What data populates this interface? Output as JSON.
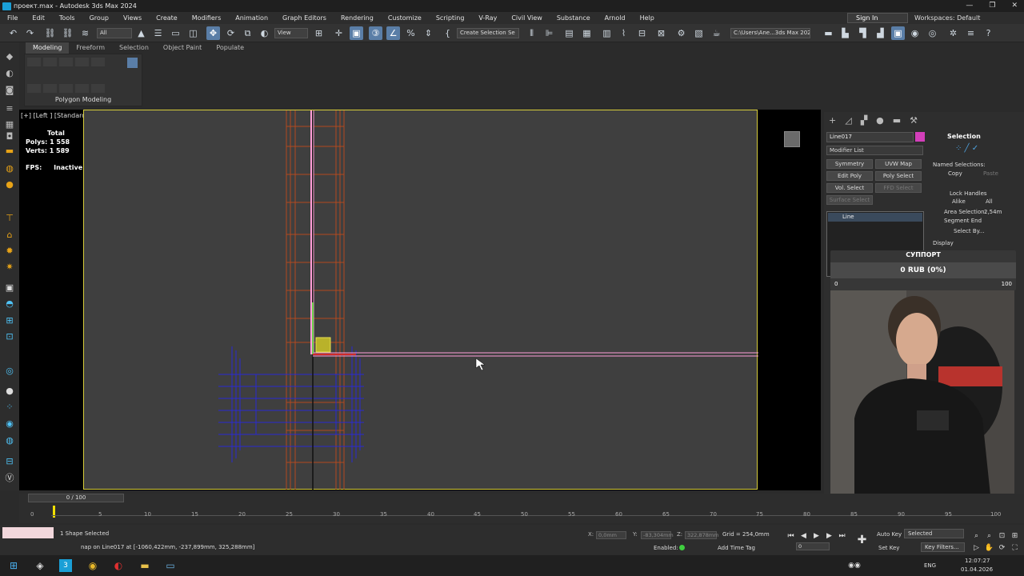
{
  "window": {
    "title": "проект.max - Autodesk 3ds Max 2024",
    "minimize": "—",
    "restore": "❐",
    "close": "✕"
  },
  "menu": {
    "items": [
      "File",
      "Edit",
      "Tools",
      "Group",
      "Views",
      "Create",
      "Modifiers",
      "Animation",
      "Graph Editors",
      "Rendering",
      "Customize",
      "Scripting",
      "V-Ray",
      "Civil View",
      "Substance",
      "Arnold",
      "Help"
    ],
    "sign_in": "Sign In",
    "workspaces": "Workspaces: Default"
  },
  "toolbar": {
    "selection_filter": "All",
    "ref_coord": "View",
    "named_selection": "Create Selection Se",
    "project_path": "C:\\Users\\Ane...3ds Max 2024"
  },
  "ribbon": {
    "tabs": [
      "Modeling",
      "Freeform",
      "Selection",
      "Object Paint",
      "Populate"
    ],
    "footer": "Polygon Modeling"
  },
  "viewport": {
    "label": "[+] [Left ] [Standard ] [Wireframe ]",
    "stats_total": "Total",
    "stats_polys": "Polys:  1 558",
    "stats_verts": "Verts:  1 589",
    "fps_label": "FPS:",
    "fps_value": "Inactive"
  },
  "command_panel": {
    "object_name": "Line017",
    "object_color": "#d33fba",
    "modifier_list": "Modifier List",
    "modifier_buttons": [
      "Symmetry",
      "UVW Map",
      "Edit Poly",
      "Poly Select",
      "Vol. Select",
      "FFD Select",
      "Surface Select"
    ],
    "stack_item": "Line",
    "selection_title": "Selection",
    "named_selections": "Named Selections:",
    "copy": "Copy",
    "paste": "Paste",
    "lock_handles": "Lock Handles",
    "alike": "Alike",
    "all": "All",
    "area_selection": "Area Selection:",
    "area_value": "2,54m",
    "segment_end": "Segment End",
    "select_by": "Select By...",
    "display": "Display"
  },
  "donation": {
    "title": "СУППОРТ",
    "amount": "0 RUB (0%)",
    "min": "0",
    "max": "100"
  },
  "timeline": {
    "slider_label": "0 / 100",
    "ticks": [
      "0",
      "5",
      "10",
      "15",
      "20",
      "25",
      "30",
      "35",
      "40",
      "45",
      "50",
      "55",
      "60",
      "65",
      "70",
      "75",
      "80",
      "85",
      "90",
      "95",
      "100"
    ]
  },
  "status": {
    "selected": "1 Shape Selected",
    "prompt": "nap on Line017 at [-1060,422mm, -237,899mm, 325,288mm]",
    "x_label": "X:",
    "x_value": "0,0mm",
    "y_label": "Y:",
    "y_value": "-83,304mm",
    "z_label": "Z:",
    "z_value": "322,878mm",
    "grid": "Grid = 254,0mm",
    "enabled": "Enabled:",
    "add_time_tag": "Add Time Tag",
    "auto_key": "Auto Key",
    "selected_dropdown": "Selected",
    "set_key": "Set Key",
    "key_filters": "Key Filters...",
    "frame": "0"
  },
  "taskbar": {
    "lang": "ENG",
    "time": "12:07:27",
    "date": "01.04.2026"
  }
}
